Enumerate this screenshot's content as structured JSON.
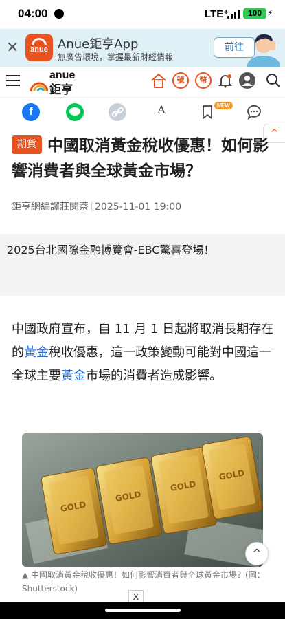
{
  "status_bar": {
    "time": "04:00",
    "network": "LTE⁺",
    "battery": "100"
  },
  "app_banner": {
    "title": "Anue鉅亨App",
    "subtitle": "無廣告環境，掌握最新財經情報",
    "open_label": "前往",
    "logo_text": "anue",
    "close_icon": "close-icon"
  },
  "header": {
    "brand_en": "anue",
    "brand_zh": "鉅亨",
    "icons": [
      "menu-icon",
      "house-icon",
      "circle-char-icon",
      "circle-char-icon",
      "bell-icon",
      "user-icon",
      "search-icon"
    ],
    "icon_chars": [
      "厲",
      "號",
      "幣"
    ]
  },
  "share": {
    "facebook": "f",
    "new_badge": "NEW",
    "font_label": "A",
    "up_label": "^"
  },
  "article": {
    "tag": "期貨",
    "headline": "中國取消黃金稅收優惠！如何影響消費者與全球黃金市場？",
    "author": "鉅亨網編譯莊閔萘",
    "datetime": "2025-11-01 19:00",
    "promo": "2025台北國際金融博覽會-EBC驚喜登場！",
    "para_1": "中國政府宣布，自 11 月 1 日起將取消長期存在的",
    "link_1": "黃金",
    "para_2": "稅收優惠，這一政策變動可能對中國這一全球主要",
    "link_2": "黃金",
    "para_3": "市場的消費者造成影響。",
    "caption": "▲ 中國取消黃金稅收優惠！如何影響消費者與全球黃金市場？(圖：Shutterstock)",
    "bar_text": "GOLD"
  },
  "footer": {
    "ad_close": "X",
    "scroll_top": "^"
  },
  "colors": {
    "brand": "#e8541f",
    "link": "#2e6cc9",
    "facebook": "#1877f2",
    "line": "#06c755"
  }
}
